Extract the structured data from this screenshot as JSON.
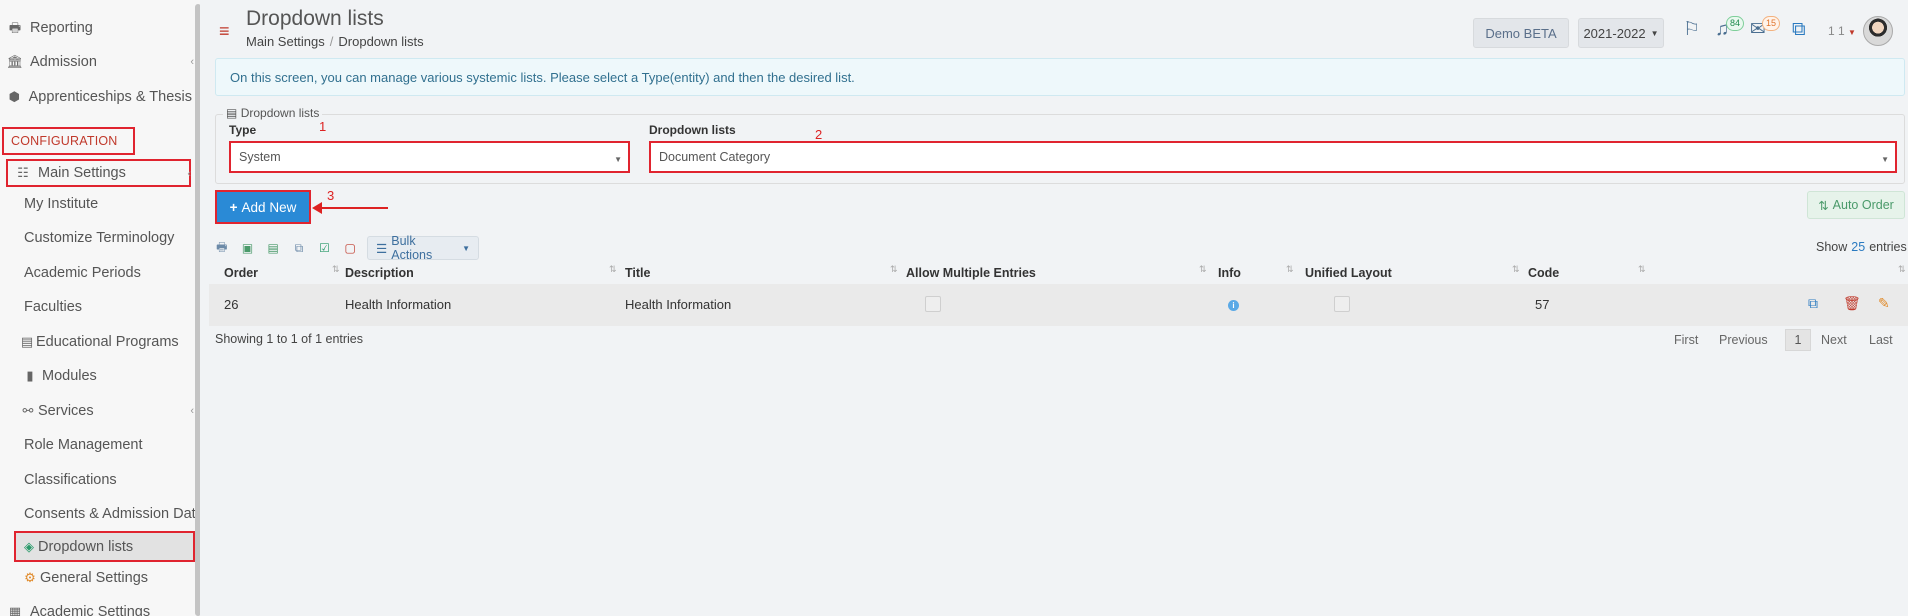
{
  "sidebar": {
    "items": [
      {
        "label": "Reporting",
        "icon": "printer-icon"
      },
      {
        "label": "Admission",
        "icon": "institution-icon"
      },
      {
        "label": "Apprenticeships & Thesis",
        "icon": "cube-icon"
      },
      {
        "label": "CONFIGURATION"
      },
      {
        "label": "Main Settings",
        "icon": "sliders-icon"
      },
      {
        "label": "My Institute"
      },
      {
        "label": "Customize Terminology"
      },
      {
        "label": "Academic Periods"
      },
      {
        "label": "Faculties"
      },
      {
        "label": "Educational Programs",
        "icon": "table-icon"
      },
      {
        "label": "Modules",
        "icon": "book-icon"
      },
      {
        "label": "Services",
        "icon": "network-icon"
      },
      {
        "label": "Role Management"
      },
      {
        "label": "Classifications"
      },
      {
        "label": "Consents & Admission Data"
      },
      {
        "label": "Dropdown lists",
        "icon": "layers-icon"
      },
      {
        "label": "General Settings",
        "icon": "gears-icon"
      },
      {
        "label": "Academic Settings",
        "icon": "calendar-icon"
      }
    ]
  },
  "header": {
    "title": "Dropdown lists",
    "breadcrumb": [
      "Main Settings",
      "/",
      "Dropdown lists"
    ],
    "demo_label": "Demo BETA",
    "year": "2021-2022",
    "notifications_count": "84",
    "messages_count": "15",
    "user_num": "1 1"
  },
  "info": {
    "text": "On this screen, you can manage various systemic lists. Please select a Type(entity) and then the desired list."
  },
  "form": {
    "legend": "Dropdown lists",
    "type_label": "Type",
    "type_value": "System",
    "list_label": "Dropdown lists",
    "list_value": "Document Category",
    "anno": [
      "1",
      "2",
      "3"
    ]
  },
  "actions": {
    "add_new": "Add New",
    "auto_order": "Auto Order",
    "bulk_actions": "Bulk Actions",
    "show_label": "Show",
    "show_count": "25",
    "entries_label": "entries"
  },
  "table": {
    "columns": [
      "Order",
      "Description",
      "Title",
      "Allow Multiple Entries",
      "Info",
      "Unified Layout",
      "Code"
    ],
    "rows": [
      {
        "order": "26",
        "description": "Health Information",
        "title": "Health Information",
        "code": "57"
      }
    ],
    "showing": "Showing 1 to 1 of 1 entries"
  },
  "pager": {
    "first": "First",
    "previous": "Previous",
    "current": "1",
    "next": "Next",
    "last": "Last"
  },
  "colors": {
    "accent": "#2a8ad6",
    "highlight": "#e0242f"
  }
}
